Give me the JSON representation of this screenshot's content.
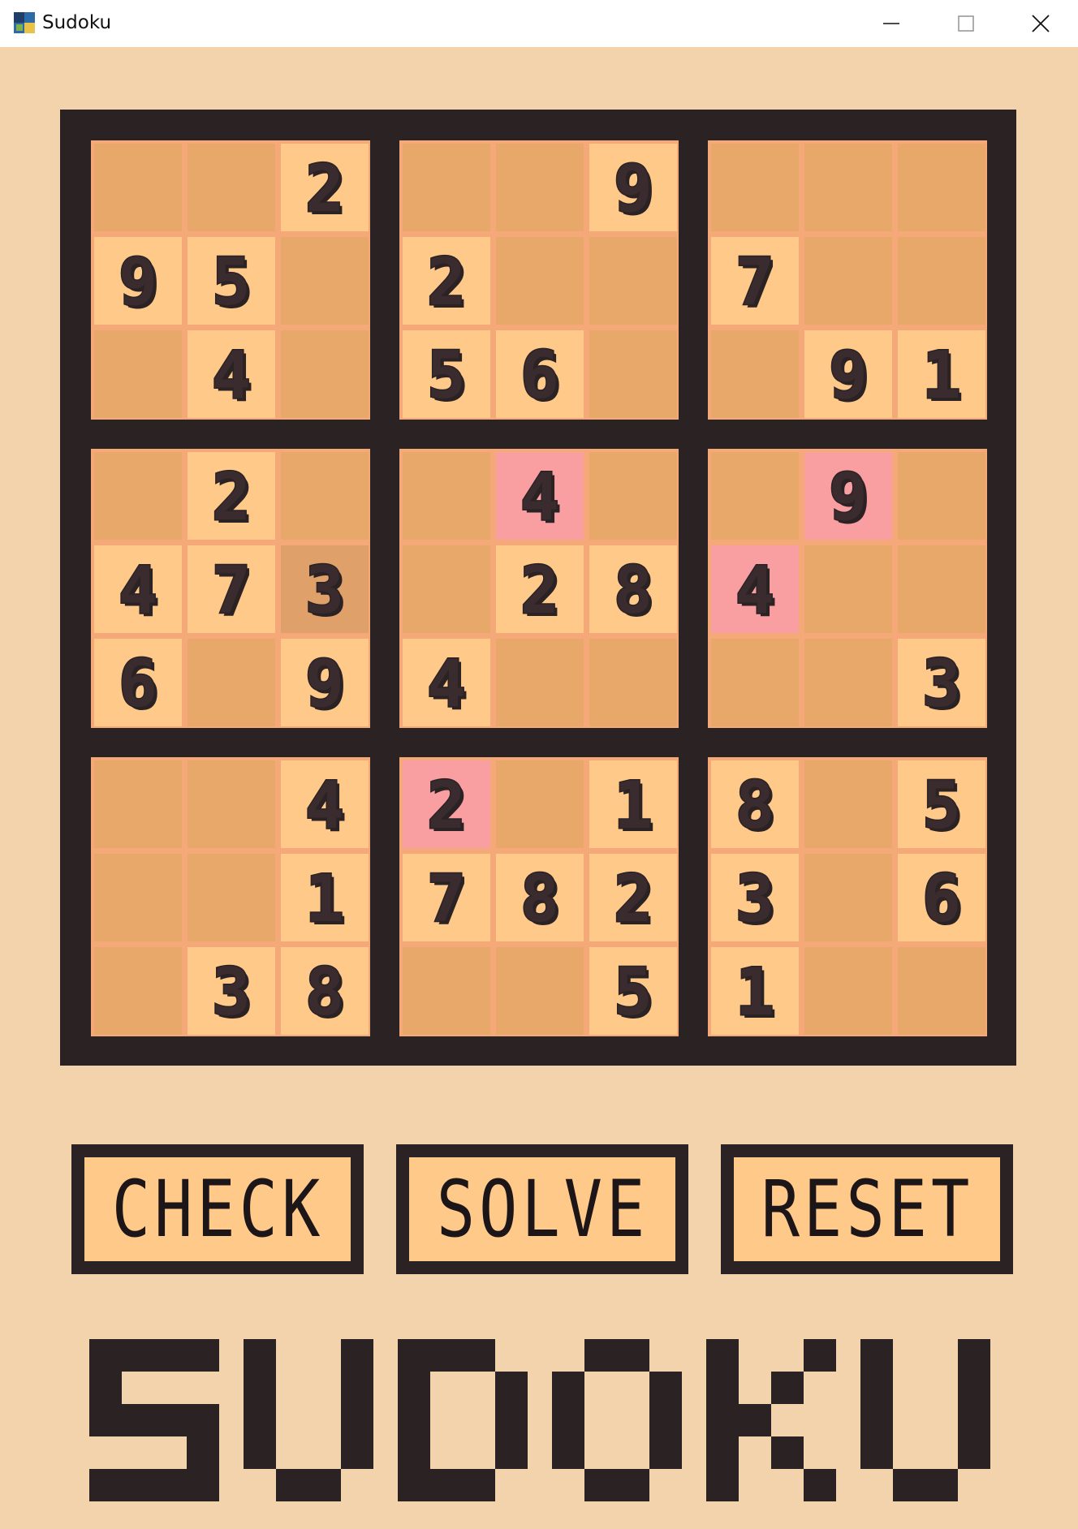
{
  "window": {
    "title": "Sudoku",
    "controls": [
      "minimize-icon",
      "maximize-icon",
      "close-icon"
    ]
  },
  "board": {
    "grid": [
      [
        0,
        0,
        2,
        0,
        0,
        9,
        0,
        0,
        0
      ],
      [
        9,
        5,
        0,
        2,
        0,
        0,
        7,
        0,
        0
      ],
      [
        0,
        4,
        0,
        5,
        6,
        0,
        0,
        9,
        1
      ],
      [
        0,
        2,
        0,
        0,
        4,
        0,
        0,
        9,
        0
      ],
      [
        4,
        7,
        3,
        0,
        2,
        8,
        4,
        0,
        0
      ],
      [
        6,
        0,
        9,
        4,
        0,
        0,
        0,
        0,
        3
      ],
      [
        0,
        0,
        4,
        2,
        0,
        1,
        8,
        0,
        5
      ],
      [
        0,
        0,
        1,
        7,
        8,
        2,
        3,
        0,
        6
      ],
      [
        0,
        3,
        8,
        0,
        0,
        5,
        1,
        0,
        0
      ]
    ],
    "error_cells": [
      [
        3,
        4
      ],
      [
        3,
        7
      ],
      [
        4,
        6
      ],
      [
        6,
        3
      ]
    ],
    "dim_cells": [
      [
        4,
        2
      ],
      [
        8,
        8
      ]
    ]
  },
  "buttons": {
    "check": "CHECK",
    "solve": "SOLVE",
    "reset": "RESET"
  },
  "title_text": "SUDOKU",
  "colors": {
    "background": "#f2d3ab",
    "board_frame": "#2b2224",
    "cell_empty": "#e8a86a",
    "cell_filled": "#ffc98a",
    "cell_error": "#f99fa2",
    "ink": "#2b2224"
  }
}
